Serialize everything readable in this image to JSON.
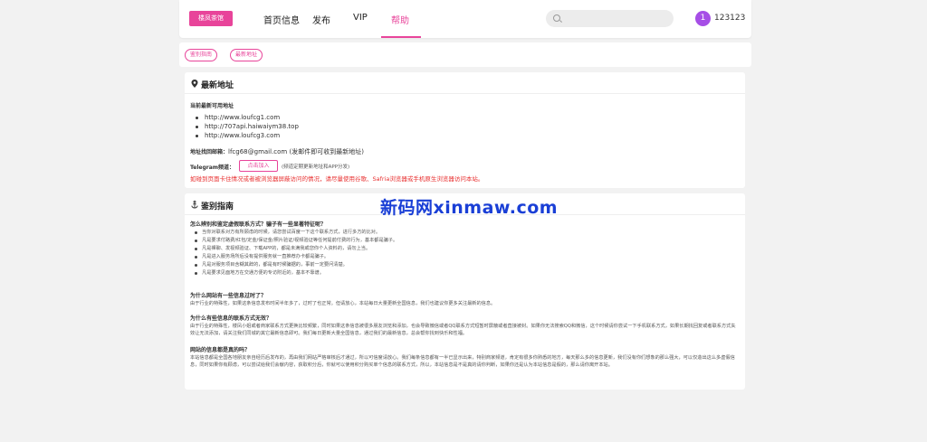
{
  "header": {
    "logo": "楼凤茶馆",
    "nav": [
      "首页信息",
      "发布",
      "VIP",
      "帮助"
    ],
    "search_placeholder": "",
    "avatar_text": "1",
    "username": "123123",
    "accent_color": "#e8449a"
  },
  "tabs": [
    "鉴别指南",
    "最新地址"
  ],
  "address_card": {
    "title": "最新地址",
    "current_label": "当前最新可用地址",
    "urls": [
      "http://www.loufcg1.com",
      "http://707api.haiwaiym38.top",
      "http://www.loufcg3.com"
    ],
    "email_label": "地址找回邮箱：",
    "email_value": "lfcg68@gmail.com (发邮件即可收到最新地址)",
    "telegram_label": "Telegram频道：",
    "telegram_button": "点击加入",
    "telegram_note": "(频道定期更新地址和APP分发)",
    "warning": "如碰到页面卡住情况或者被浏览器屏蔽访问的情况，请尽量使用谷歌、Safria浏览器或手机原生浏览器访问本站。"
  },
  "watermark": "新码网xinmaw.com",
  "guide_card": {
    "title": "鉴别指南",
    "sections": [
      {
        "q": "怎么辨别和鉴定虚假联系方式？骗子有一些显著特征呢？",
        "items": [
          "当你对联系对方有所顾虑的时候，请您尝试百度一下这个联系方式，进行多方的比对。",
          "凡是要求付路费/红包/定金/保证金/照片验证/视频验证等任何提前付费的行为，基本都是骗子。",
          "凡是裸聊、发视频验证、下载APP的，都是未满我或您你个人资料的，请勿上当。",
          "凡是进入服务场所后没有提供服务就一直推荐办卡都是骗子。",
          "凡是对服务项目含糊其辞的，都是有时候骗据的，事前一定要问清楚。",
          "凡是要求见面地方在交通方便的专访附近的，基本不靠谱。"
        ]
      },
      {
        "q": "为什么网站有一些信息过时了？",
        "a": "由于行业的特殊性，如果这条信息发布时间半年多了，过时了也正常。但请放心，本站每日大量更新全国信息，我们也建议你更多关注最新的信息。"
      },
      {
        "q": "为什么有些信息的联系方式无效？",
        "a": "由于行业的特殊性，楼凤小姐或者商家联系方式更换比较频繁，同时如果这条信息被很多朋友浏览和添加，也会导致微信或者QQ联系方式短暂时屏蔽或者直接被封。如果你无法搜索QQ和微信，这个时候请你尝试一下手机联系方式，如果长期找回复或者联系方式失效让无法添加，请关注我们同城的其它最新信息即可。我们每日更新大量全国信息，通过我们的最新信息，总会帮你找到快乐和性福。"
      },
      {
        "q": "网站的信息都是真的吗？",
        "a": "本站信息都是全国各地朋友亲自经历后发布的，再由我们网站严格审核后才通过，所以可信度请放心。我们每条信息都有一半已显示出来，特别商家频道，肯定有很多你熟悉的地方，每天那么多的信息更新，我们没有你们想象的那么强大，可以仅造出这么多虚假信息，同时如果你有顾虑，可以尝试给我们会献内容，获取积分后，你就可以使用积分购买单个信息的联系方式，所以，本站信息是不是真的请你判断，如果你还是认为本站信息是假的，那么请你离开本站。"
      }
    ]
  }
}
